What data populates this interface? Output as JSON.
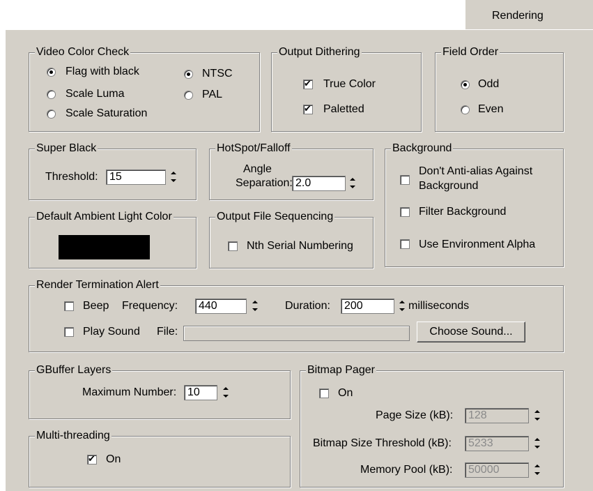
{
  "tab": {
    "label": "Rendering"
  },
  "video_color_check": {
    "title": "Video Color Check",
    "options_left": [
      "Flag with black",
      "Scale Luma",
      "Scale Saturation"
    ],
    "options_right": [
      "NTSC",
      "PAL"
    ]
  },
  "output_dithering": {
    "title": "Output Dithering",
    "true_color": "True Color",
    "paletted": "Paletted"
  },
  "field_order": {
    "title": "Field Order",
    "odd": "Odd",
    "even": "Even"
  },
  "super_black": {
    "title": "Super Black",
    "threshold_label": "Threshold:",
    "threshold_value": "15"
  },
  "hotspot": {
    "title": "HotSpot/Falloff",
    "angle_label_1": "Angle",
    "angle_label_2": "Separation:",
    "value": "2.0"
  },
  "background": {
    "title": "Background",
    "antialias_1": "Don't Anti-alias Against",
    "antialias_2": "Background",
    "filter": "Filter Background",
    "env_alpha": "Use Environment Alpha"
  },
  "ambient": {
    "title": "Default Ambient Light Color",
    "color": "#000000"
  },
  "file_seq": {
    "title": "Output File Sequencing",
    "nth": "Nth Serial Numbering"
  },
  "termination": {
    "title": "Render Termination Alert",
    "beep": "Beep",
    "frequency_label": "Frequency:",
    "frequency_value": "440",
    "duration_label": "Duration:",
    "duration_value": "200",
    "ms": "milliseconds",
    "play_sound": "Play Sound",
    "file_label": "File:",
    "choose": "Choose Sound..."
  },
  "gbuffer": {
    "title": "GBuffer Layers",
    "max_label": "Maximum Number:",
    "max_value": "10"
  },
  "multithreading": {
    "title": "Multi-threading",
    "on": "On"
  },
  "bitmap_pager": {
    "title": "Bitmap Pager",
    "on": "On",
    "page_size_label": "Page Size (kB):",
    "page_size_value": "128",
    "threshold_label": "Bitmap Size Threshold (kB):",
    "threshold_value": "5233",
    "pool_label": "Memory Pool (kB):",
    "pool_value": "50000"
  }
}
